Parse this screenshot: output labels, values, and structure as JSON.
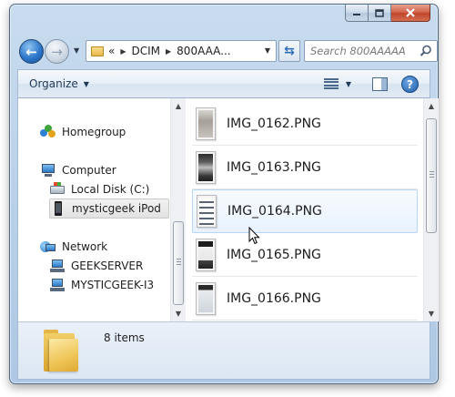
{
  "window": {
    "caption_buttons": {
      "minimize_icon": "minimize-icon",
      "maximize_icon": "maximize-icon",
      "close_icon": "close-icon"
    }
  },
  "navigation": {
    "back_icon": "back-arrow-icon",
    "forward_icon": "forward-arrow-icon",
    "address": {
      "overflow": "«",
      "crumbs": [
        "DCIM",
        "800AAA..."
      ]
    },
    "refresh_icon": "refresh-icon",
    "search": {
      "placeholder": "Search 800AAAAA"
    }
  },
  "toolbar": {
    "organize_label": "Organize",
    "views_icon": "views-icon",
    "preview_icon": "preview-pane-icon",
    "help_label": "?"
  },
  "nav_pane": {
    "items": [
      {
        "label": "Homegroup",
        "icon": "homegroup-icon",
        "indent": 0
      },
      {
        "label": "Computer",
        "icon": "computer-icon",
        "indent": 0
      },
      {
        "label": "Local Disk (C:)",
        "icon": "disk-icon",
        "indent": 1
      },
      {
        "label": "mysticgeek iPod",
        "icon": "ipod-icon",
        "indent": 1,
        "selected": true
      },
      {
        "label": "Network",
        "icon": "network-icon",
        "indent": 0
      },
      {
        "label": "GEEKSERVER",
        "icon": "network-computer-icon",
        "indent": 1
      },
      {
        "label": "MYSTICGEEK-I3",
        "icon": "network-computer-icon",
        "indent": 1
      }
    ]
  },
  "files": [
    {
      "name": "IMG_0162.PNG"
    },
    {
      "name": "IMG_0163.PNG"
    },
    {
      "name": "IMG_0164.PNG",
      "hovered": true
    },
    {
      "name": "IMG_0165.PNG"
    },
    {
      "name": "IMG_0166.PNG"
    }
  ],
  "details": {
    "icon": "folder-icon",
    "item_count": "8 items"
  }
}
